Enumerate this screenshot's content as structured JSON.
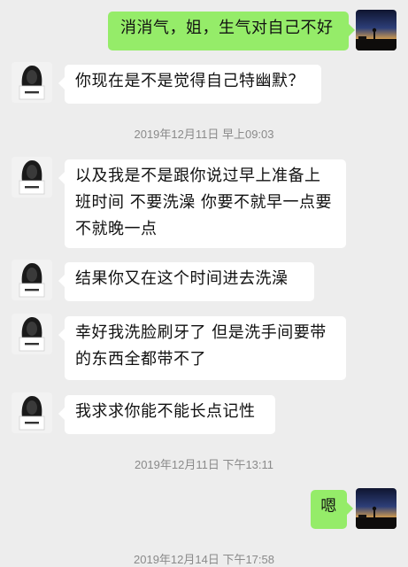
{
  "messages": [
    {
      "side": "right",
      "avatar": "sunset-photo-avatar",
      "text": "消消气，姐，生气对自己不好"
    },
    {
      "side": "left",
      "avatar": "girl-sign-avatar",
      "text": "你现在是不是觉得自己特幽默？"
    },
    {
      "side": "left",
      "avatar": "girl-sign-avatar",
      "text": "以及我是不是跟你说过早上准备上班时间 不要洗澡 你要不就早一点要不就晚一点"
    },
    {
      "side": "left",
      "avatar": "girl-sign-avatar",
      "text": "结果你又在这个时间进去洗澡"
    },
    {
      "side": "left",
      "avatar": "girl-sign-avatar",
      "text": "幸好我洗脸刷牙了 但是洗手间要带的东西全都带不了"
    },
    {
      "side": "left",
      "avatar": "girl-sign-avatar",
      "text": "我求求你能不能长点记性"
    },
    {
      "side": "right",
      "avatar": "sunset-photo-avatar",
      "text": "嗯"
    }
  ],
  "timestamps": [
    "2019年12月11日 早上09:03",
    "2019年12月11日 下午13:11",
    "2019年12月14日 下午17:58"
  ],
  "colors": {
    "background": "#ededed",
    "bubble_left": "#ffffff",
    "bubble_right": "#95ec69",
    "timestamp_text": "#8a8a8a"
  }
}
